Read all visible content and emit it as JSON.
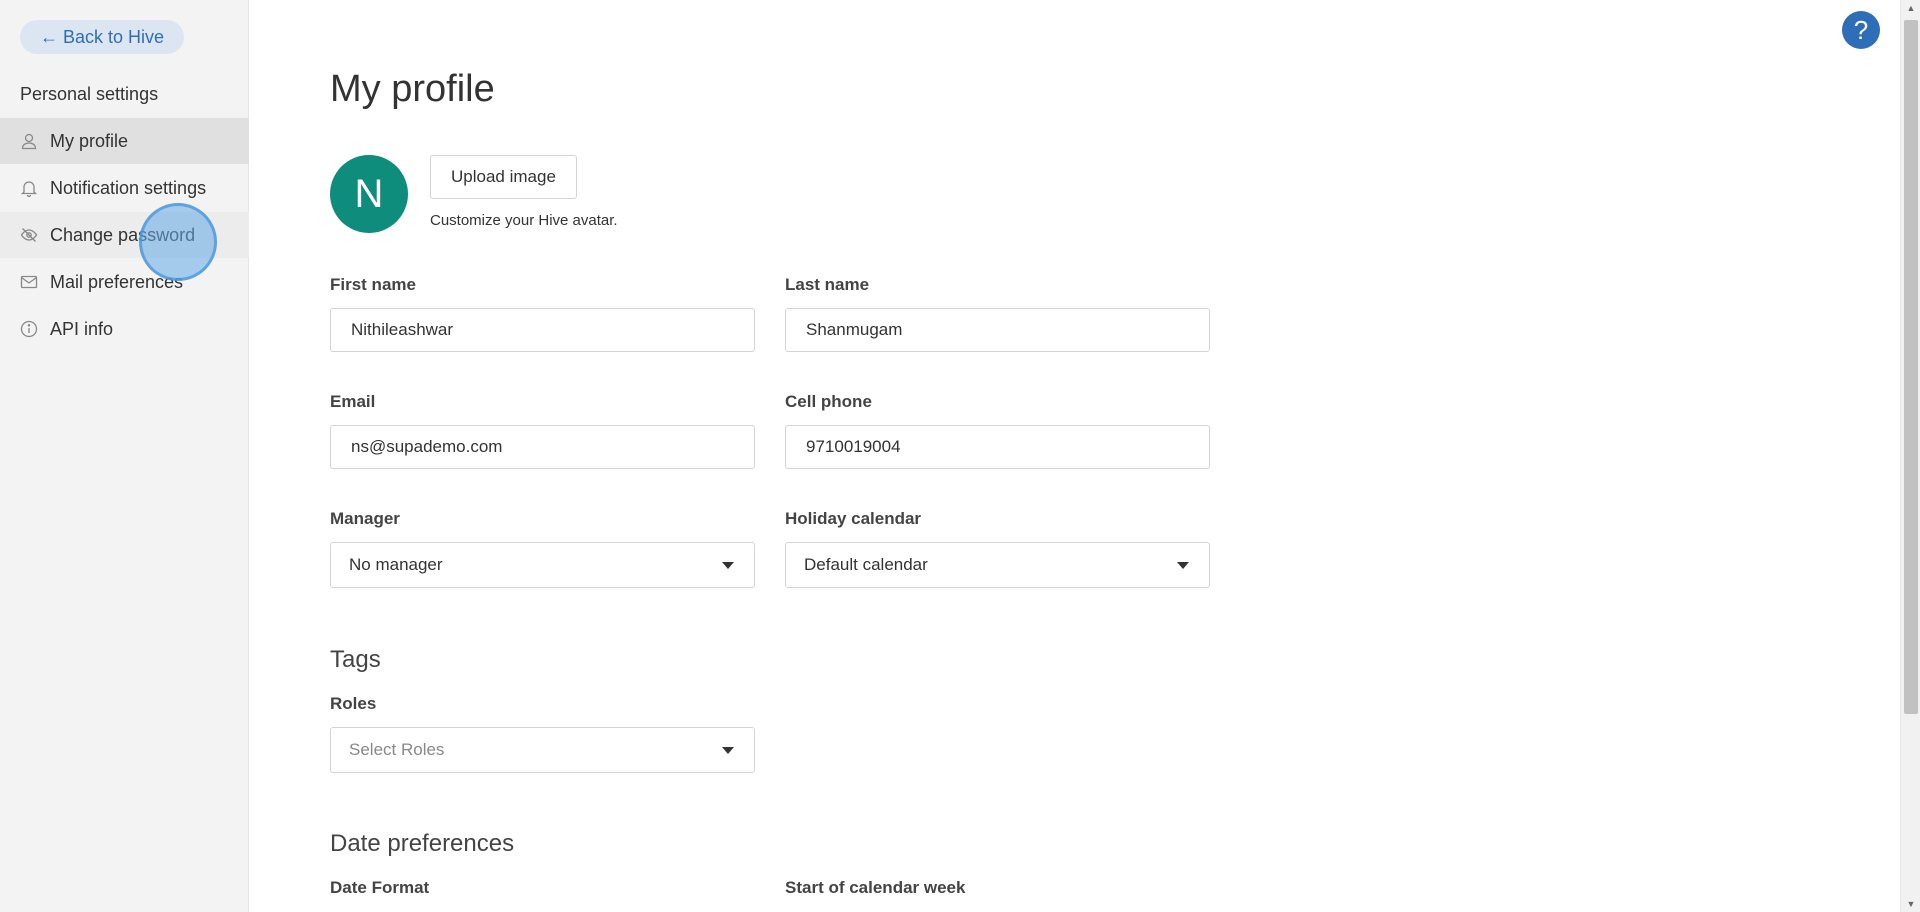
{
  "sidebar": {
    "back_label": "← Back to Hive",
    "heading": "Personal settings",
    "items": [
      {
        "label": "My profile",
        "icon": "user-icon"
      },
      {
        "label": "Notification settings",
        "icon": "bell-icon"
      },
      {
        "label": "Change password",
        "icon": "eye-slash-icon"
      },
      {
        "label": "Mail preferences",
        "icon": "envelope-icon"
      },
      {
        "label": "API info",
        "icon": "info-icon"
      }
    ]
  },
  "main": {
    "title": "My profile",
    "avatar_initial": "N",
    "avatar_color": "#0e8c7c",
    "upload_label": "Upload image",
    "avatar_hint": "Customize your Hive avatar.",
    "fields": {
      "first_name": {
        "label": "First name",
        "value": "Nithileashwar"
      },
      "last_name": {
        "label": "Last name",
        "value": "Shanmugam"
      },
      "email": {
        "label": "Email",
        "value": "ns@supademo.com"
      },
      "cell_phone": {
        "label": "Cell phone",
        "value": "9710019004"
      },
      "manager": {
        "label": "Manager",
        "value": "No manager"
      },
      "holiday_calendar": {
        "label": "Holiday calendar",
        "value": "Default calendar"
      }
    },
    "tags": {
      "title": "Tags",
      "roles_label": "Roles",
      "roles_placeholder": "Select Roles"
    },
    "date_prefs": {
      "title": "Date preferences",
      "date_format_label": "Date Format",
      "week_start_label": "Start of calendar week"
    }
  },
  "help_label": "?",
  "colors": {
    "accent": "#2e6db8",
    "back_bg": "#dce6f3"
  }
}
